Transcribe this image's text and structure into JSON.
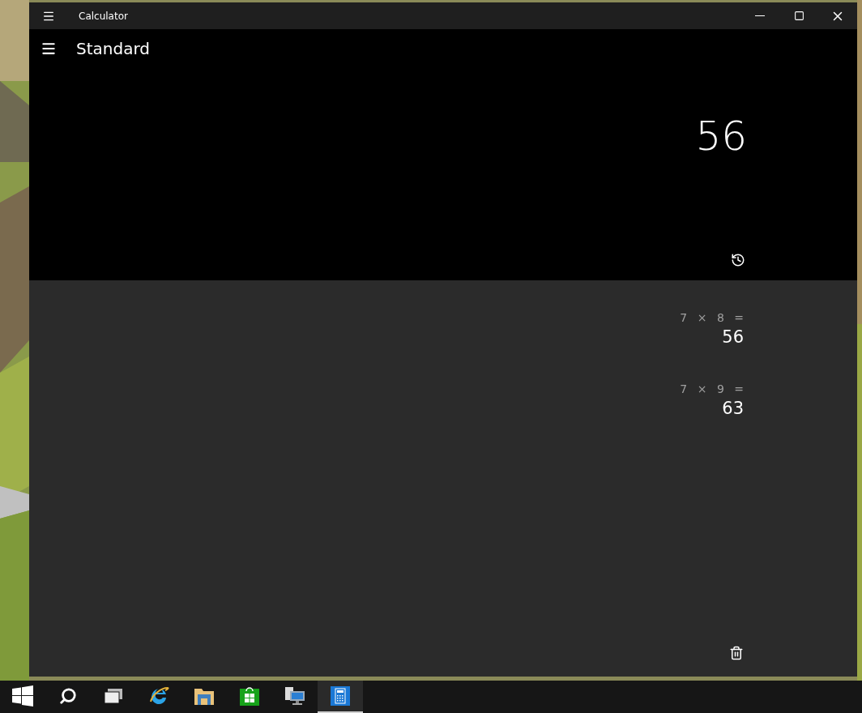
{
  "window": {
    "title": "Calculator"
  },
  "mode": {
    "title": "Standard"
  },
  "display": {
    "value": "56"
  },
  "history": [
    {
      "expression": "7 × 8 =",
      "result": "56"
    },
    {
      "expression": "7 × 9 =",
      "result": "63"
    }
  ],
  "taskbar": [
    {
      "kind": "start",
      "selected": false
    },
    {
      "kind": "search",
      "selected": false
    },
    {
      "kind": "taskview",
      "selected": false
    },
    {
      "kind": "browser",
      "selected": false
    },
    {
      "kind": "folder",
      "selected": false
    },
    {
      "kind": "store",
      "selected": false
    },
    {
      "kind": "remote",
      "selected": false
    },
    {
      "kind": "calculator",
      "selected": true
    }
  ]
}
